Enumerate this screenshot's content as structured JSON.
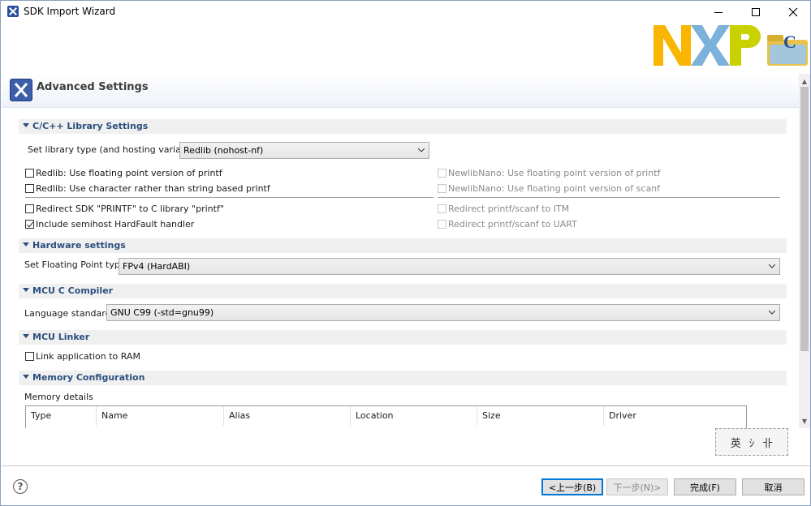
{
  "window": {
    "title": "SDK Import Wizard",
    "buttons": [
      "minimize",
      "maximize",
      "close"
    ]
  },
  "banner": {
    "logo": "NXP",
    "logo_accent": "C"
  },
  "header": {
    "title": "Advanced Settings"
  },
  "sections": {
    "library": {
      "title": "C/C++ Library Settings",
      "set_library_label": "Set library type (and hosting variant)",
      "library_value": "Redlib (nohost-nf)",
      "options_left": [
        {
          "label": "Redlib: Use floating point version of printf",
          "checked": false
        },
        {
          "label": "Redlib: Use character rather than string based printf",
          "checked": false
        },
        {
          "label": "Redirect SDK \"PRINTF\" to C library \"printf\"",
          "checked": false
        },
        {
          "label": "Include semihost HardFault handler",
          "checked": true
        }
      ],
      "options_right": [
        {
          "label": "NewlibNano: Use floating point version of printf",
          "checked": false
        },
        {
          "label": "NewlibNano: Use floating point version of scanf",
          "checked": false
        },
        {
          "label": "Redirect printf/scanf to ITM",
          "checked": false
        },
        {
          "label": "Redirect printf/scanf to UART",
          "checked": false
        }
      ]
    },
    "hardware": {
      "title": "Hardware settings",
      "fp_label": "Set Floating Point type",
      "fp_value": "FPv4 (HardABI)"
    },
    "compiler": {
      "title": "MCU C Compiler",
      "lang_label": "Language standard",
      "lang_value": "GNU C99 (-std=gnu99)"
    },
    "linker": {
      "title": "MCU Linker",
      "link_ram_label": "Link application to RAM",
      "link_ram_checked": false
    },
    "memory": {
      "title": "Memory Configuration",
      "details_label": "Memory details",
      "columns": [
        "Type",
        "Name",
        "Alias",
        "Location",
        "Size",
        "Driver"
      ]
    }
  },
  "ime": {
    "chars": [
      "英",
      "ｼ",
      "卝"
    ]
  },
  "footer": {
    "help": "?",
    "back": "<上一步(B)",
    "next": "下一步(N)>",
    "finish": "完成(F)",
    "cancel": "取消"
  },
  "colors": {
    "section_text": "#2b4f7e",
    "nxp_yellow": "#f9b500",
    "nxp_green": "#c9d200",
    "nxp_blue": "#7bb1db"
  }
}
